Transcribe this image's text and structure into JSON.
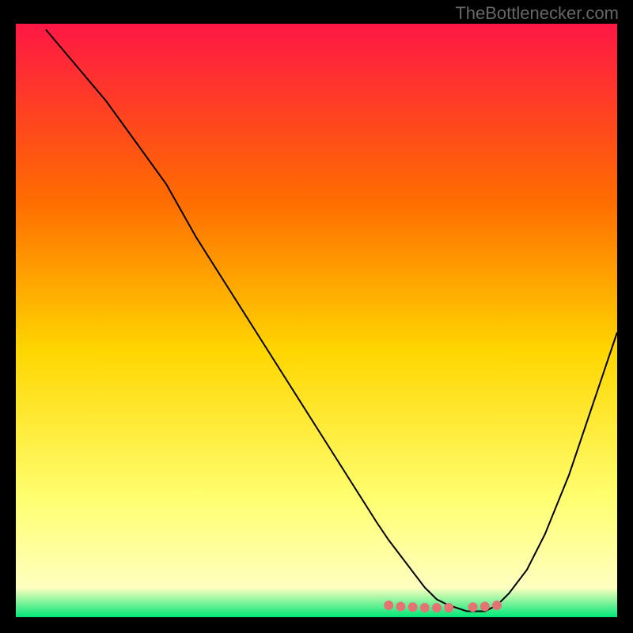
{
  "watermark": "TheBottlenecker.com",
  "chart_data": {
    "type": "line",
    "title": "",
    "xlabel": "",
    "ylabel": "",
    "xlim": [
      0,
      100
    ],
    "ylim": [
      0,
      100
    ],
    "background_gradient": {
      "top": "#ff1744",
      "mid_upper": "#ff6d00",
      "mid": "#ffd600",
      "mid_lower": "#ffff70",
      "lower": "#ffffc0",
      "bottom": "#00e676"
    },
    "series": [
      {
        "name": "curve",
        "stroke": "#000000",
        "stroke_width": 2,
        "x": [
          5,
          10,
          15,
          20,
          25,
          30,
          35,
          40,
          45,
          50,
          55,
          60,
          62,
          65,
          68,
          70,
          72,
          75,
          78,
          80,
          82,
          85,
          88,
          92,
          96,
          100
        ],
        "values": [
          99,
          93,
          87,
          80,
          73,
          64,
          56,
          48,
          40,
          32,
          24,
          16,
          13,
          9,
          5,
          3,
          2,
          1,
          1,
          2,
          4,
          8,
          14,
          24,
          36,
          48
        ]
      }
    ],
    "markers": {
      "name": "bottom-cluster",
      "fill": "#e57373",
      "radius": 6,
      "x": [
        62,
        64,
        66,
        68,
        70,
        72,
        76,
        78,
        80
      ],
      "values": [
        2.0,
        1.8,
        1.7,
        1.6,
        1.6,
        1.6,
        1.7,
        1.8,
        2.0
      ]
    }
  }
}
